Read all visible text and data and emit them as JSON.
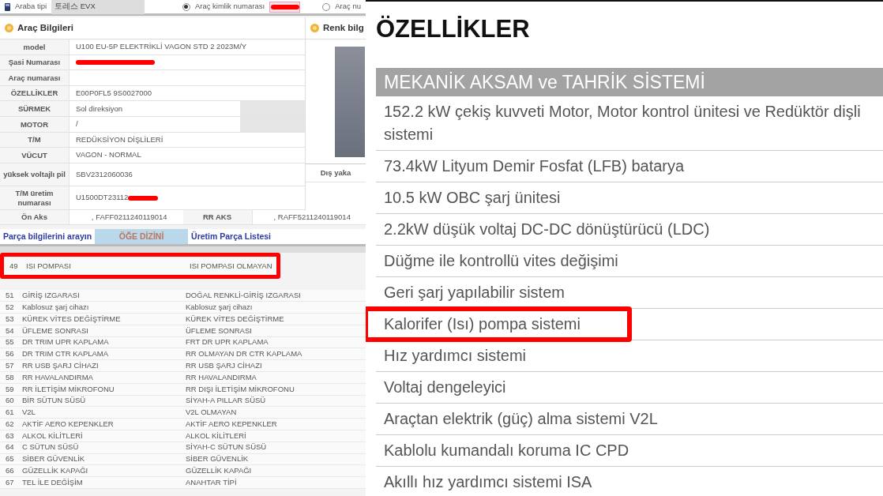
{
  "left_panel": {
    "top_bar": {
      "car_type_label": "Araba tipi",
      "car_type_value": "토레스 EVX",
      "search_options": [
        {
          "label": "Araç kimlik numarası",
          "selected": true,
          "field_redacted": true
        },
        {
          "label": "Araç nu",
          "selected": false,
          "field_redacted": false
        }
      ]
    },
    "vehicle_info": {
      "title": "Araç Bilgileri",
      "rows": [
        {
          "label": "model",
          "value": "U100 EU-5P ELEKTRİKLİ VAGON STD 2 2023M/Y",
          "redacted": false,
          "shaded_cell": false
        },
        {
          "label": "Şasi Numarası",
          "redacted": true,
          "shaded_cell": false
        },
        {
          "label": "Araç numarası",
          "redacted": false,
          "shaded_cell": false
        },
        {
          "label": "ÖZELLİKLER",
          "value": "E00P0FL5 9S0027000",
          "redacted": false,
          "shaded_cell": false
        },
        {
          "label": "SÜRMEK",
          "value": "Sol direksiyon",
          "redacted": false,
          "shaded_cell": true
        },
        {
          "label": "MOTOR",
          "value": "/",
          "redacted": false,
          "shaded_cell": true
        },
        {
          "label": "T/M",
          "value": "REDÜKSİYON DİŞLİLERİ",
          "redacted": false,
          "shaded_cell": false
        },
        {
          "label": "VÜCUT",
          "value": "VAGON - NORMAL",
          "redacted": false,
          "shaded_cell": false
        },
        {
          "label": "yüksek voltajlı pil",
          "value": "SBV2312060036",
          "redacted": false,
          "shaded_cell": false
        },
        {
          "label": "T/M üretim numarası",
          "value": "U1500DT23112",
          "redacted": true,
          "shaded_cell": false
        }
      ],
      "axles": [
        {
          "label": "Ön Aks",
          "value": ", FAFF0211240119014"
        },
        {
          "label": "RR AKS",
          "value": ", RAFF5211240119014"
        }
      ]
    },
    "color_info": {
      "title": "Renk bilg",
      "label": "Dış yaka"
    },
    "tabs": [
      {
        "label": "Parça bilgilerini arayın",
        "selected": false
      },
      {
        "label": "ÖĞE DİZİNİ",
        "selected": true
      },
      {
        "label": "Üretim Parça Listesi",
        "selected": false
      }
    ],
    "item_list": [
      {
        "number": "49",
        "name": "ISI POMPASI",
        "value": "ISI POMPASI OLMAYAN",
        "highlighted": true
      },
      {
        "number": "51",
        "name": "GİRİŞ IZGARASI",
        "value": "DOĞAL RENKLİ-GİRİŞ IZGARASI",
        "highlighted": false
      },
      {
        "number": "52",
        "name": "Kablosuz şarj cihazı",
        "value": "Kablosuz şarj cihazı",
        "highlighted": false
      },
      {
        "number": "53",
        "name": "KÜREK VİTES DEĞİŞTİRME",
        "value": "KÜREK VİTES DEĞİŞTİRME",
        "highlighted": false
      },
      {
        "number": "54",
        "name": "ÜFLEME SONRASI",
        "value": "ÜFLEME SONRASI",
        "highlighted": false
      },
      {
        "number": "55",
        "name": "DR TRIM UPR KAPLAMA",
        "value": "FRT DR UPR KAPLAMA",
        "highlighted": false
      },
      {
        "number": "56",
        "name": "DR TRIM CTR KAPLAMA",
        "value": "RR OLMAYAN DR CTR KAPLAMA",
        "highlighted": false
      },
      {
        "number": "57",
        "name": "RR USB ŞARJ CİHAZI",
        "value": "RR USB ŞARJ CİHAZI",
        "highlighted": false
      },
      {
        "number": "58",
        "name": "RR HAVALANDIRMA",
        "value": "RR HAVALANDIRMA",
        "highlighted": false
      },
      {
        "number": "59",
        "name": "RR İLETİŞİM MİKROFONU",
        "value": "RR DIŞI İLETİŞİM MİKROFONU",
        "highlighted": false
      },
      {
        "number": "60",
        "name": "BİR SÜTUN SÜSÜ",
        "value": "SİYAH-A PILLAR SÜSÜ",
        "highlighted": false
      },
      {
        "number": "61",
        "name": "V2L",
        "value": "V2L OLMAYAN",
        "highlighted": false
      },
      {
        "number": "62",
        "name": "AKTİF AERO KEPENKLER",
        "value": "AKTİF AERO KEPENKLER",
        "highlighted": false
      },
      {
        "number": "63",
        "name": "ALKOL KİLİTLERİ",
        "value": "ALKOL KİLİTLERİ",
        "highlighted": false
      },
      {
        "number": "64",
        "name": "C SÜTUN SÜSÜ",
        "value": "SİYAH-C SÜTUN SÜSÜ",
        "highlighted": false
      },
      {
        "number": "65",
        "name": "SİBER GÜVENLİK",
        "value": "SİBER GÜVENLİK",
        "highlighted": false
      },
      {
        "number": "66",
        "name": "GÜZELLİK KAPAĞI",
        "value": "GÜZELLİK KAPAĞI",
        "highlighted": false
      },
      {
        "number": "67",
        "name": "TEL İLE DEĞİŞİM",
        "value": "ANAHTAR TİPİ",
        "highlighted": false
      }
    ]
  },
  "right_panel": {
    "title": "ÖZELLİKLER",
    "section": "MEKANİK AKSAM ve TAHRİK SİSTEMİ",
    "features": [
      {
        "text": "152.2 kW çekiş kuvveti Motor, Motor kontrol ünitesi ve Redüktör dişli sistemi",
        "highlighted": false
      },
      {
        "text": "73.4kW Lityum Demir Fosfat (LFB) batarya",
        "highlighted": false
      },
      {
        "text": "10.5 kW OBC şarj ünitesi",
        "highlighted": false
      },
      {
        "text": "2.2kW düşük voltaj DC-DC dönüştürücü  (LDC)",
        "highlighted": false
      },
      {
        "text": "Düğme ile kontrollü vites değişimi",
        "highlighted": false
      },
      {
        "text": "Geri şarj yapılabilir sistem",
        "highlighted": false
      },
      {
        "text": "Kalorifer (Isı) pompa sistemi",
        "highlighted": true
      },
      {
        "text": "Hız yardımcı sistemi",
        "highlighted": false
      },
      {
        "text": "Voltaj dengeleyici",
        "highlighted": false
      },
      {
        "text": "Araçtan elektrik (güç) alma sistemi V2L",
        "highlighted": false
      },
      {
        "text": "Kablolu kumandalı koruma IC CPD",
        "highlighted": false
      },
      {
        "text": "Akıllı hız yardımcı sistemi ISA",
        "highlighted": false
      }
    ]
  }
}
